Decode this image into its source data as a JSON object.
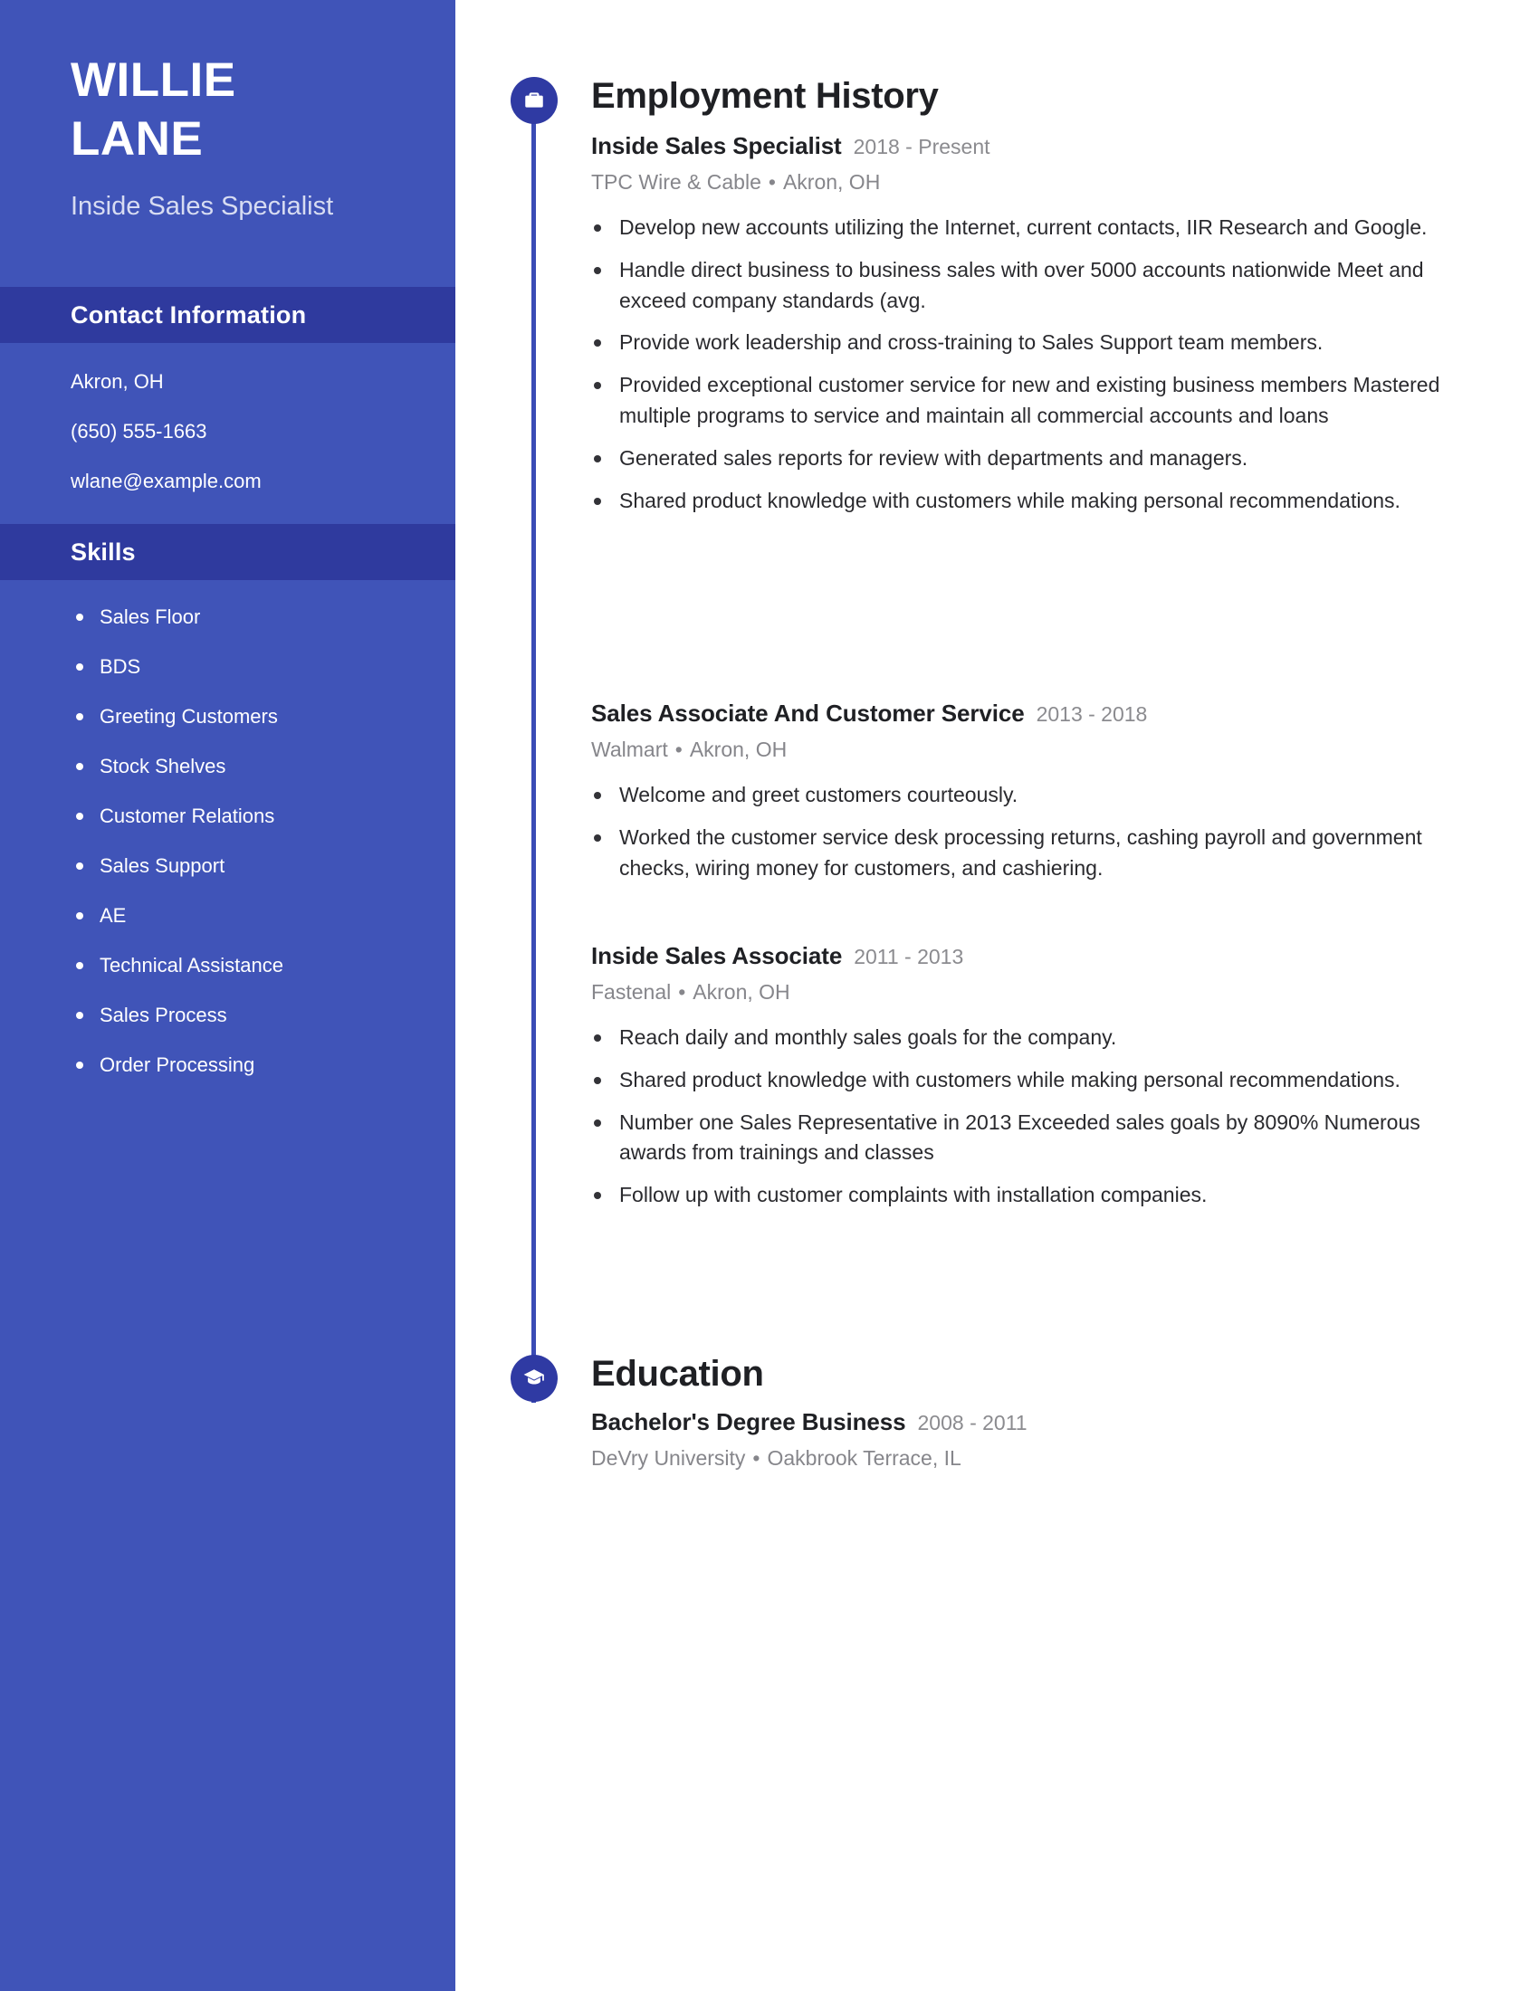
{
  "sidebar": {
    "name_first": "WILLIE",
    "name_last": "LANE",
    "job_title": "Inside Sales Specialist",
    "contact": {
      "heading": "Contact Information",
      "lines": [
        "Akron, OH",
        "(650) 555-1663",
        "wlane@example.com"
      ]
    },
    "skills": {
      "heading": "Skills",
      "items": [
        "Sales Floor",
        "BDS",
        "Greeting Customers",
        "Stock Shelves",
        "Customer Relations",
        "Sales Support",
        "AE",
        "Technical Assistance",
        "Sales Process",
        "Order Processing"
      ]
    }
  },
  "main": {
    "employment": {
      "heading": "Employment History",
      "icon": "briefcase-icon",
      "entries": [
        {
          "role": "Inside Sales Specialist",
          "dates": "2018 - Present",
          "company": "TPC Wire & Cable",
          "separator": "•",
          "location": "Akron, OH",
          "bullets": [
            "Develop new accounts utilizing the Internet, current contacts, IIR Research and Google.",
            "Handle direct business to business sales with over 5000 accounts nationwide Meet and exceed company standards (avg.",
            "Provide work leadership and cross-training to Sales Support team members.",
            "Provided exceptional customer service for new and existing business members Mastered multiple programs to service and maintain all commercial accounts and loans",
            "Generated sales reports for review with departments and managers.",
            "Shared product knowledge with customers while making personal recommendations."
          ]
        },
        {
          "role": "Sales Associate And Customer Service",
          "dates": "2013 - 2018",
          "company": "Walmart",
          "separator": "•",
          "location": "Akron, OH",
          "bullets": [
            "Welcome and greet customers courteously.",
            "Worked the customer service desk processing returns, cashing payroll and government checks, wiring money for customers, and cashiering."
          ]
        },
        {
          "role": "Inside Sales Associate",
          "dates": "2011 - 2013",
          "company": "Fastenal",
          "separator": "•",
          "location": "Akron, OH",
          "bullets": [
            "Reach daily and monthly sales goals for the company.",
            "Shared product knowledge with customers while making personal recommendations.",
            "Number one Sales Representative in 2013 Exceeded sales goals by 8090% Numerous awards from trainings and classes",
            "Follow up with customer complaints with installation companies."
          ]
        }
      ]
    },
    "education": {
      "heading": "Education",
      "icon": "graduation-cap-icon",
      "entries": [
        {
          "degree": "Bachelor's Degree Business",
          "dates": "2008 - 2011",
          "school": "DeVry University",
          "separator": "•",
          "location": "Oakbrook Terrace, IL"
        }
      ]
    }
  },
  "colors": {
    "sidebar_bg": "#4054b8",
    "sidebar_head_bg": "#2f3a9e",
    "icon_bg": "#2f3aa3",
    "timeline": "#3a4bb5",
    "heading_text": "#1f2024",
    "muted_text": "#86868b"
  }
}
